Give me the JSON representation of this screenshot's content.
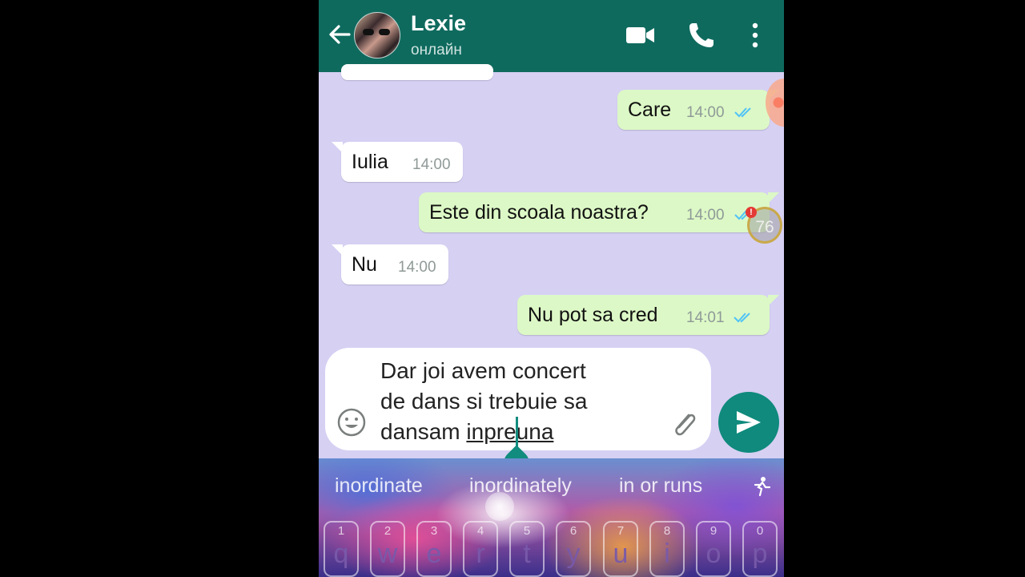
{
  "header": {
    "contact_name": "Lexie",
    "contact_status": "онлайн",
    "icons": [
      "back-arrow-icon",
      "video-call-icon",
      "phone-icon",
      "more-options-icon"
    ],
    "color": "#0f6a5e"
  },
  "messages": [
    {
      "direction": "out",
      "text": "Care",
      "time": "14:00",
      "status": "read"
    },
    {
      "direction": "in",
      "text": "Iulia",
      "time": "14:00"
    },
    {
      "direction": "out",
      "text": "Este din scoala noastra?",
      "time": "14:00",
      "status": "read"
    },
    {
      "direction": "in",
      "text": "Nu",
      "time": "14:00"
    },
    {
      "direction": "out",
      "text": "Nu pot sa cred",
      "time": "14:01",
      "status": "read"
    }
  ],
  "floating_badge": {
    "count": "76",
    "alert": "!"
  },
  "composer": {
    "line1": "Dar joi avem concert",
    "line2": "de dans si trebuie sa",
    "line3_prefix": "dansam ",
    "line3_word": "inpreuna"
  },
  "keyboard": {
    "suggestions": [
      "inordinate",
      "inordinately",
      "in or runs"
    ],
    "keys": [
      {
        "num": "1",
        "letter": "q"
      },
      {
        "num": "2",
        "letter": "w"
      },
      {
        "num": "3",
        "letter": "e"
      },
      {
        "num": "4",
        "letter": "r"
      },
      {
        "num": "5",
        "letter": "t"
      },
      {
        "num": "6",
        "letter": "y"
      },
      {
        "num": "7",
        "letter": "u"
      },
      {
        "num": "8",
        "letter": "i"
      },
      {
        "num": "9",
        "letter": "o"
      },
      {
        "num": "0",
        "letter": "p"
      }
    ]
  },
  "colors": {
    "chat_bg": "#d6d0f3",
    "outgoing_bubble": "#dcf8c6",
    "accent": "#0f8a7c",
    "read_ticks": "#4fc3f7"
  }
}
